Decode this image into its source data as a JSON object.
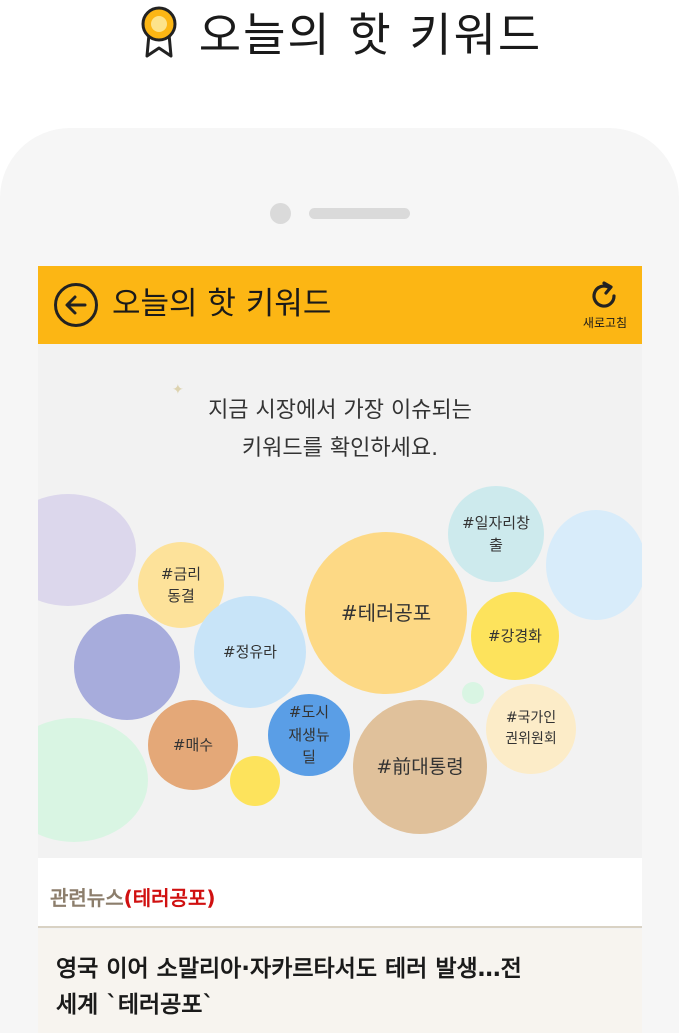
{
  "page": {
    "title": "오늘의 핫 키워드"
  },
  "header": {
    "title": "오늘의 핫 키워드",
    "refresh_label": "새로고침"
  },
  "intro": {
    "line1": "지금 시장에서 가장 이슈되는",
    "line2": "키워드를 확인하세요."
  },
  "keywords": [
    {
      "lines": [
        "#금리",
        "동결"
      ]
    },
    {
      "lines": [
        "#정유라"
      ]
    },
    {
      "lines": [
        "#테러공포"
      ]
    },
    {
      "lines": [
        "#일자리창",
        "출"
      ]
    },
    {
      "lines": [
        "#강경화"
      ]
    },
    {
      "lines": [
        "#매수"
      ]
    },
    {
      "lines": [
        "#도시",
        "재생뉴",
        "딜"
      ]
    },
    {
      "lines": [
        "#前대통령"
      ]
    },
    {
      "lines": [
        "#국가인",
        "권위원회"
      ]
    }
  ],
  "news": {
    "label_prefix": "관련뉴스",
    "label_keyword": "(테러공포)",
    "headline_line1": "영국 이어 소말리아·자카르타서도 테러 발생…전",
    "headline_line2": "세계 `테러공포`"
  },
  "colors": {
    "accent": "#fcb614",
    "bubble_purple_light": "#dcd7ec",
    "bubble_blue_light": "#d8ecfa",
    "bubble_yellow_light": "#fde29a",
    "bubble_cyan_light": "#cdeaed",
    "bubble_blue": "#c8e4f8",
    "bubble_indigo": "#a7acdc",
    "bubble_yellow": "#fdd985",
    "bubble_yellow_bright": "#fde35c",
    "bubble_mint": "#d9f5e3",
    "bubble_orange": "#e4a878",
    "bubble_mid_blue": "#5a9ee6",
    "bubble_tan": "#e0c19b",
    "bubble_cream": "#fcecc8",
    "news_red": "#d01010"
  },
  "icons": {
    "page_medal": "medal-icon",
    "back": "back-arrow-icon",
    "refresh": "refresh-icon"
  }
}
